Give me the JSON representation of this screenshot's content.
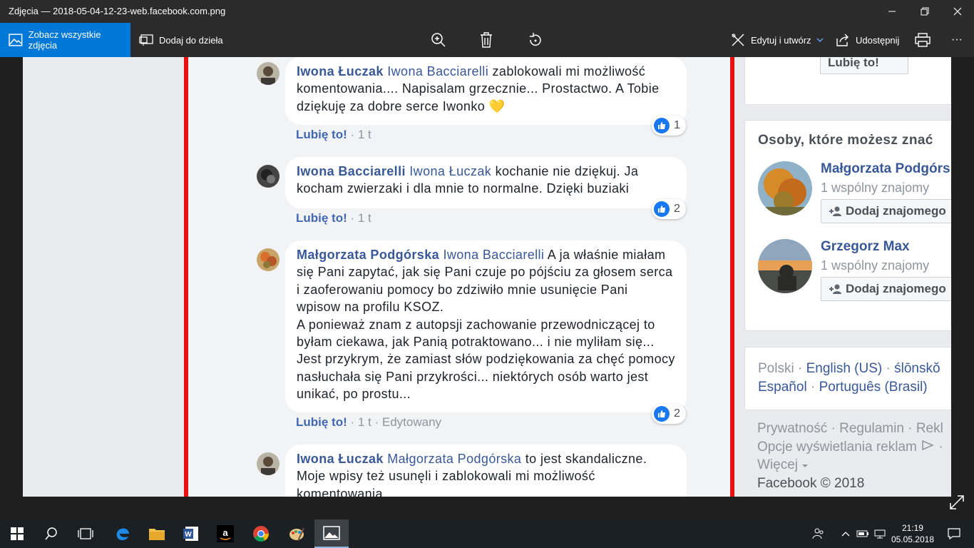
{
  "window": {
    "title": "Zdjęcia — 2018-05-04-12-23-web.facebook.com.png",
    "minimize": "—",
    "restore": "❐",
    "close": "✕"
  },
  "toolbar": {
    "see_all": "Zobacz wszystkie zdjęcia",
    "add_to": "Dodaj do dzieła",
    "edit": "Edytuj i utwórz",
    "share": "Udostępnij",
    "more": "···"
  },
  "comments": [
    {
      "author": "Iwona Łuczak",
      "mention": "Iwona Bacciarelli",
      "text": "zablokowali mi możliwość komentowania.... Napisalam grzecznie... Prostactwo. A Tobie dziękuję za dobre serce Iwonko 💛",
      "like": "Lubię to!",
      "time": "1 t",
      "reactions": "1"
    },
    {
      "author": "Iwona Bacciarelli",
      "mention": "Iwona Łuczak",
      "text": "kochanie nie dziękuj. Ja kocham zwierzaki i dla mnie to normalne. Dzięki buziaki",
      "like": "Lubię to!",
      "time": "1 t",
      "reactions": "2"
    },
    {
      "author": "Małgorzata Podgórska",
      "mention": "Iwona Bacciarelli",
      "text": "A ja właśnie miałam się Pani zapytać, jak się Pani czuje po pójściu za głosem serca i zaoferowaniu pomocy bo zdziwiło mnie usunięcie Pani wpisow na profilu KSOZ.",
      "text2": "A ponieważ znam z autopsji zachowanie przewodniczącej to byłam ciekawa, jak Panią potraktowano... i nie myliłam się... Jest przykrym, że zamiast słów podziękowania za chęć pomocy nasłuchała się Pani przykrości... niektórych osób warto jest unikać, po prostu...",
      "like": "Lubię to!",
      "time": "1 t",
      "edited": "Edytowany",
      "reactions": "2"
    },
    {
      "author": "Iwona Łuczak",
      "mention": "Małgorzata Podgórska",
      "text": "to jest skandaliczne. Moje wpisy też usunęli i zablokowali mi możliwość komentowania..."
    }
  ],
  "sidebar": {
    "top_button": "Lubię to!",
    "pymk_title": "Osoby, które możesz znać",
    "people": [
      {
        "name": "Małgorzata Podgórska",
        "mutual": "1 wspólny znajomy",
        "add": "Dodaj znajomego"
      },
      {
        "name": "Grzegorz Max",
        "mutual": "1 wspólny znajomy",
        "add": "Dodaj znajomego"
      }
    ],
    "languages": {
      "current": "Polski",
      "l1": "English (US)",
      "l2": "ślōnskŏ",
      "l3": "Español",
      "l4": "Português (Brasil)"
    },
    "footer": {
      "privacy": "Prywatność",
      "terms": "Regulamin",
      "ads": "Rekl",
      "ad_choices": "Opcje wyświetlania reklam",
      "more": "Więcej",
      "copyright": "Facebook © 2018"
    }
  },
  "taskbar": {
    "time": "21:19",
    "date": "05.05.2018"
  }
}
